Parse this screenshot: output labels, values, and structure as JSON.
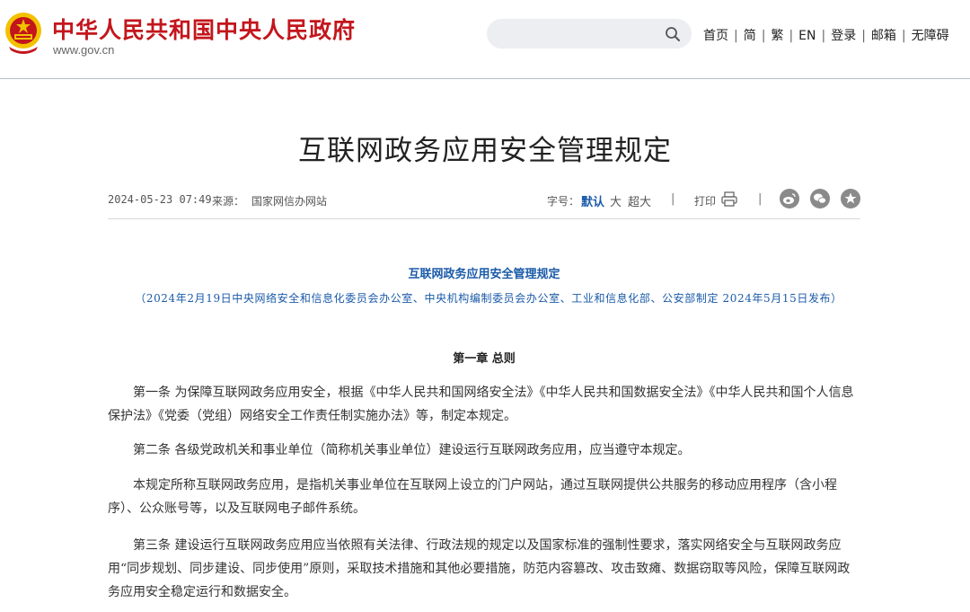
{
  "header": {
    "site_name": "中华人民共和国中央人民政府",
    "site_url": "www.gov.cn",
    "search": {
      "value": "",
      "placeholder": ""
    },
    "nav": [
      "首页",
      "简",
      "繁",
      "EN",
      "登录",
      "邮箱",
      "无障碍"
    ],
    "emblem_icon": "national-emblem-icon",
    "search_icon": "search-icon"
  },
  "article": {
    "title": "互联网政务应用安全管理规定",
    "date": "2024-05-23 07:49",
    "source_label": "来源：",
    "source": "国家网信办网站",
    "font_size_label": "字号：",
    "font_size_default": "默认",
    "font_size_large": "大",
    "font_size_xlarge": "超大",
    "separator": "|",
    "print_label": "打印",
    "icons": [
      "print-icon",
      "weibo-icon",
      "wechat-icon",
      "favorite-icon"
    ]
  },
  "body": {
    "doc_title": "互联网政务应用安全管理规定",
    "doc_subtitle": "（2024年2月19日中央网络安全和信息化委员会办公室、中央机构编制委员会办公室、工业和信息化部、公安部制定 2024年5月15日发布）",
    "chapter": "第一章 总则",
    "paragraphs": [
      "第一条 为保障互联网政务应用安全，根据《中华人民共和国网络安全法》《中华人民共和国数据安全法》《中华人民共和国个人信息保护法》《党委（党组）网络安全工作责任制实施办法》等，制定本规定。",
      "第二条 各级党政机关和事业单位（简称机关事业单位）建设运行互联网政务应用，应当遵守本规定。",
      "本规定所称互联网政务应用，是指机关事业单位在互联网上设立的门户网站，通过互联网提供公共服务的移动应用程序（含小程序）、公众账号等，以及互联网电子邮件系统。",
      "第三条 建设运行互联网政务应用应当依照有关法律、行政法规的规定以及国家标准的强制性要求，落实网络安全与互联网政务应用“同步规划、同步建设、同步使用”原则，采取技术措施和其他必要措施，防范内容篡改、攻击致瘫、数据窃取等风险，保障互联网政务应用安全稳定运行和数据安全。"
    ]
  },
  "colors": {
    "brand_red": "#c3161c",
    "link_blue": "#1a5aa8",
    "emblem_gold": "#f2c200"
  }
}
